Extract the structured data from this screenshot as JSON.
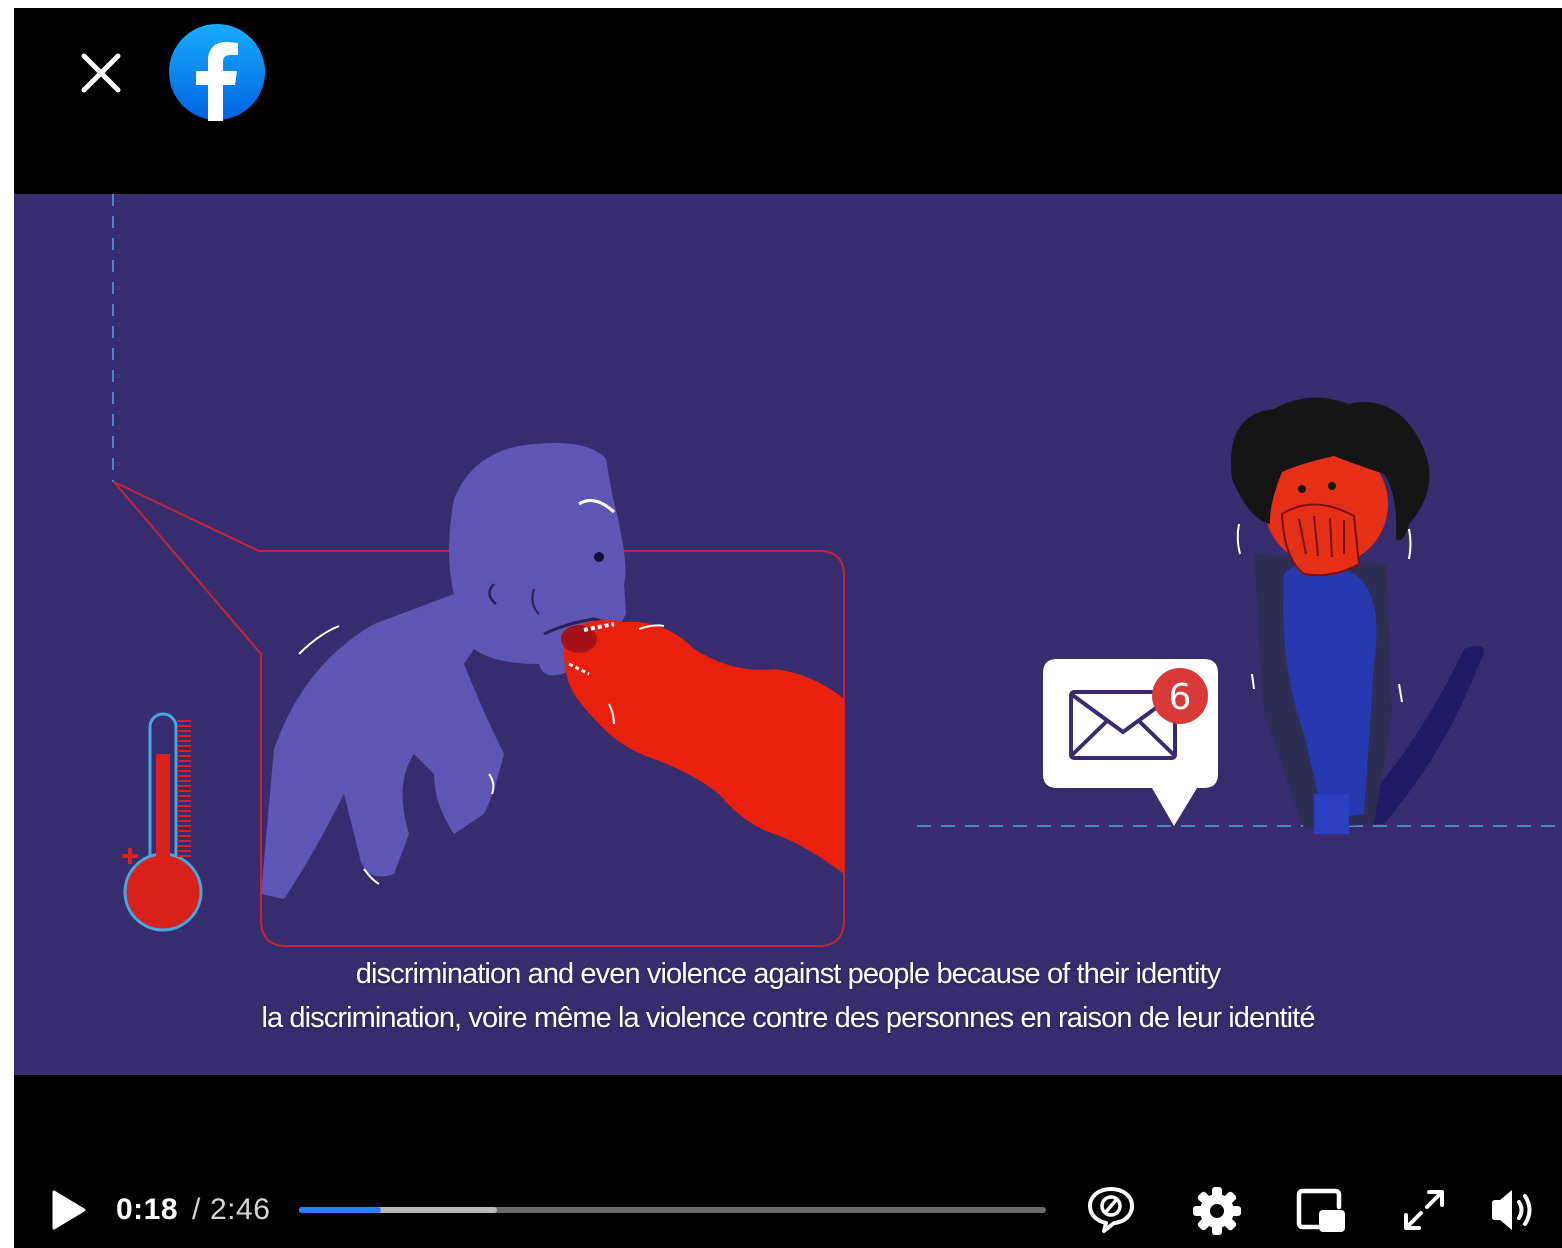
{
  "subtitles": {
    "english": "discrimination and even violence against people because of their identity",
    "french": "la discrimination, voire même la violence contre des personnes en raison de leur identité"
  },
  "notification_badge": "6",
  "player": {
    "current_time": "0:18",
    "separator": "/",
    "duration": "2:46",
    "played_fraction": 0.11,
    "buffered_fraction": 0.265
  },
  "icons": {
    "close": "close-icon",
    "logo": "facebook-logo",
    "play": "play-icon",
    "captions_off": "captions-off-icon",
    "settings": "gear-icon",
    "miniplayer": "picture-in-picture-icon",
    "fullscreen": "fullscreen-icon",
    "volume": "volume-icon"
  },
  "colors": {
    "background": "#000000",
    "scene": "#372c6d",
    "accent_red": "#e8200c",
    "progress": "#2d7ff9",
    "facebook_blue": "#1877f2"
  }
}
